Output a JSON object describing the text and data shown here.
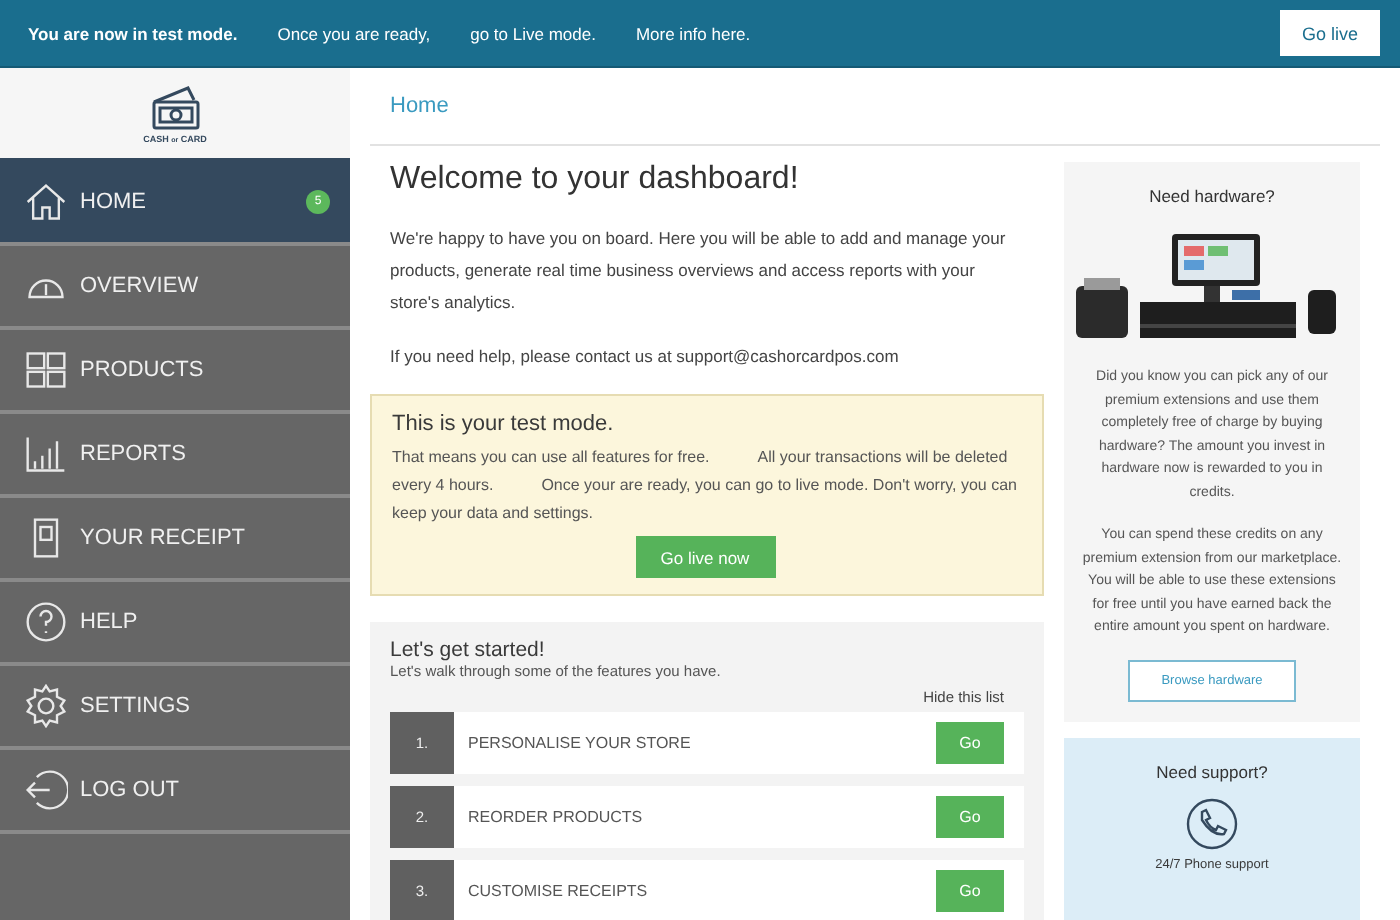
{
  "top_bar": {
    "title": "You are now in test mode.",
    "messages": [
      "Once you are ready,",
      "go to Live mode.",
      "More info here."
    ],
    "button": "Go live"
  },
  "logo": {
    "text_main": "CASH",
    "text_small": "or",
    "text_end": "CARD"
  },
  "sidebar": {
    "items": [
      {
        "label": "HOME",
        "kind": "home",
        "selected": true,
        "badge": "5"
      },
      {
        "label": "OVERVIEW",
        "kind": "gauge",
        "selected": false
      },
      {
        "label": "PRODUCTS",
        "kind": "grid",
        "selected": false
      },
      {
        "label": "REPORTS",
        "kind": "bars",
        "selected": false
      },
      {
        "label": "YOUR RECEIPT",
        "kind": "receipt",
        "selected": false
      },
      {
        "label": "HELP",
        "kind": "help",
        "selected": false
      },
      {
        "label": "SETTINGS",
        "kind": "gear",
        "selected": false
      },
      {
        "label": "LOG OUT",
        "kind": "logout",
        "selected": false
      }
    ]
  },
  "breadcrumb": "Home",
  "welcome": {
    "title": "Welcome to your dashboard!",
    "paragraphs": [
      "We're happy to have you on board. Here you will be able to add and manage your products, generate real time business overviews and access reports with your store's analytics.",
      "If you need help, please contact us at support@cashorcardpos.com"
    ]
  },
  "test_mode": {
    "title": "This is your test mode.",
    "text": [
      "That means you can use all features for free.",
      "All your transactions will be deleted every 4 hours.",
      "Once your are ready, you can go to live mode. Don't worry, you can keep your data and settings."
    ],
    "button": "Go live now"
  },
  "get_started": {
    "title": "Let's get started!",
    "subtitle": "Let's walk through some of the features you have.",
    "hide_link": "Hide this list",
    "steps": [
      {
        "number": "1.",
        "label": "PERSONALISE YOUR STORE",
        "button": "Go"
      },
      {
        "number": "2.",
        "label": "REORDER PRODUCTS",
        "button": "Go"
      },
      {
        "number": "3.",
        "label": "CUSTOMISE RECEIPTS",
        "button": "Go"
      }
    ]
  },
  "hardware": {
    "title": "Need hardware?",
    "image": {
      "kind": "picture"
    },
    "paragraphs": [
      "Did you know you can pick any of our premium extensions and use them completely free of charge by buying hardware? The amount you invest in hardware now is rewarded to you in credits.",
      "You can spend these credits on any premium extension from our marketplace. You will be able to use these extensions for free until you have earned back the entire amount you spent on hardware."
    ],
    "button": "Browse hardware"
  },
  "support": {
    "title": "Need support?",
    "line": "24/7 Phone support"
  }
}
